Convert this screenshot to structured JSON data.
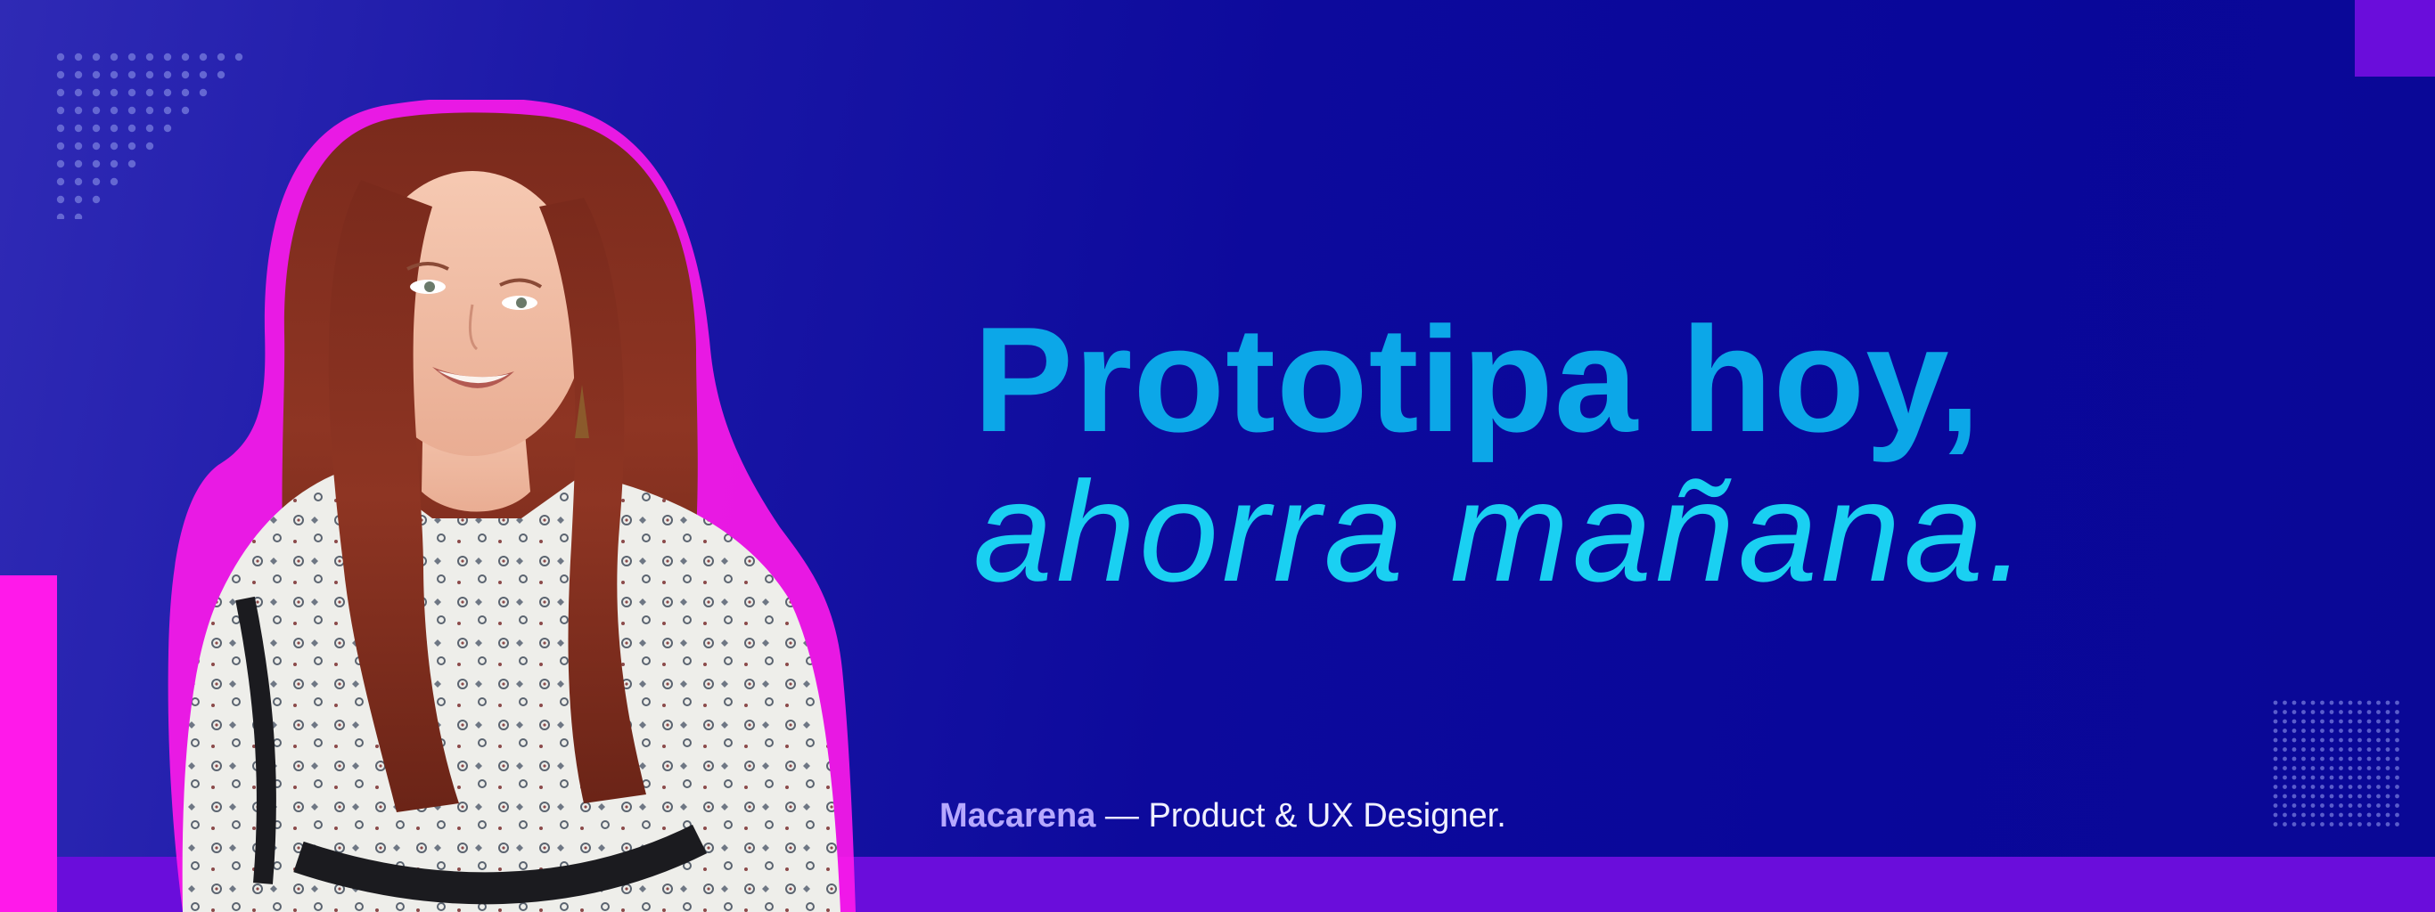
{
  "headline": {
    "line1": "Prototipa hoy,",
    "line2": "ahorra mañana."
  },
  "signature": {
    "name": "Macarena",
    "separator": " — ",
    "role": "Product & UX Designer."
  },
  "colors": {
    "background_start": "#2f2ab5",
    "background_end": "#0a0896",
    "headline_primary": "#0ca7e8",
    "headline_secondary": "#1ad0f2",
    "accent_purple": "#6a0ddb",
    "accent_magenta": "#ff19ea",
    "dots": "#6f73d8"
  },
  "icons": {
    "top_left": "dot-pattern-triangle",
    "bottom_right": "dot-pattern-grid"
  },
  "portrait": {
    "subject": "woman-with-long-auburn-hair-portrait"
  }
}
